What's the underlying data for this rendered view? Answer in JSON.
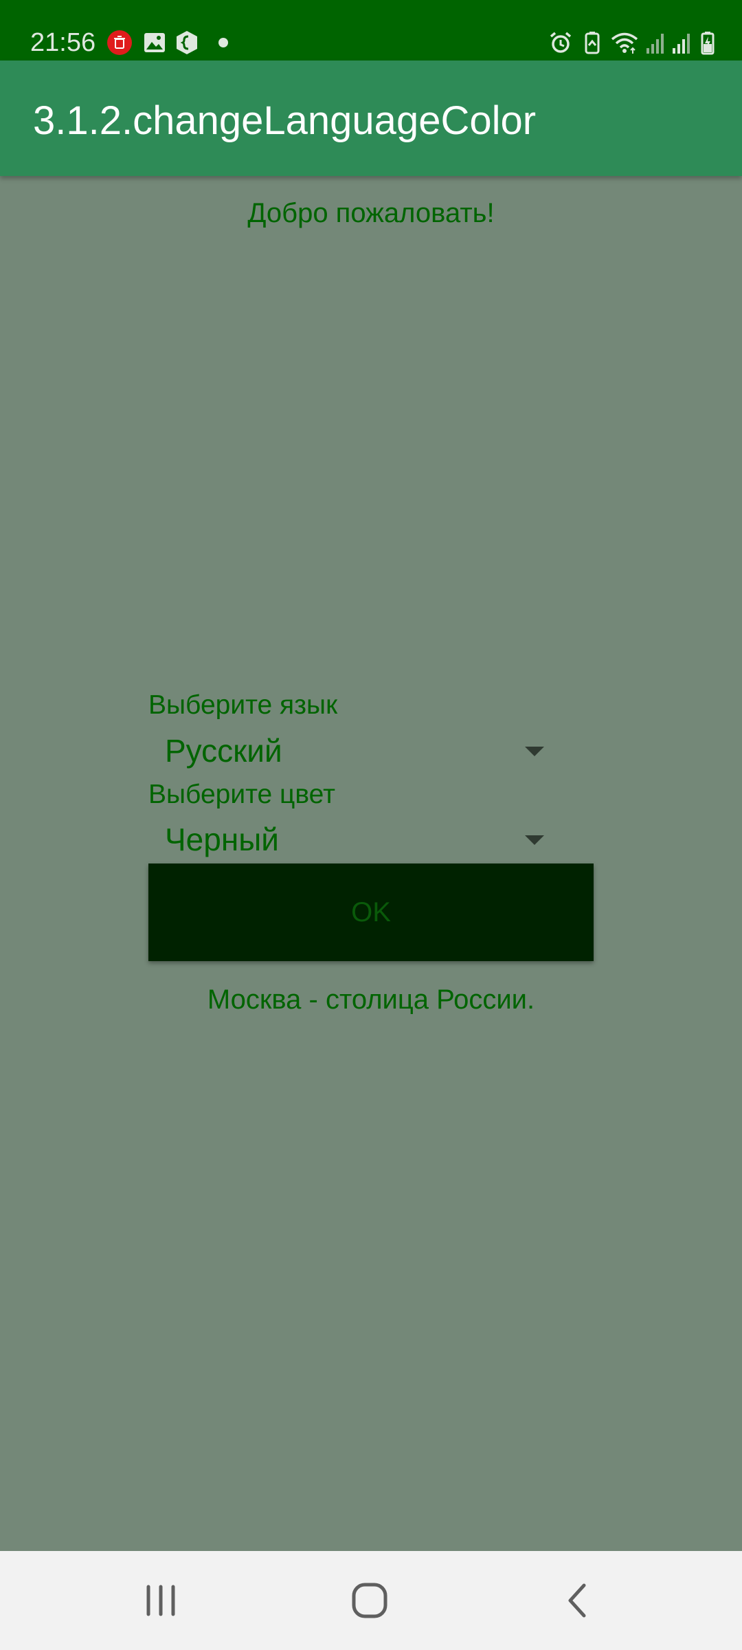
{
  "status_bar": {
    "time": "21:56",
    "left_icons": [
      "delete-notification-icon",
      "image-icon",
      "app-shield-icon",
      "dot-indicator"
    ],
    "right_icons": [
      "alarm-icon",
      "battery-saver-icon",
      "wifi-icon",
      "signal-icon",
      "signal-icon-2",
      "battery-charging-icon"
    ]
  },
  "app_bar": {
    "title": "3.1.2.changeLanguageColor",
    "color": "#2e8b57"
  },
  "main": {
    "welcome": "Добро пожаловать!",
    "language_label": "Выберите язык",
    "language_value": "Русский",
    "color_label": "Выберите цвет",
    "color_value": "Черный",
    "ok_label": "OK",
    "capital_text": "Москва - столица России.",
    "text_color": "#006400",
    "background": "#748878"
  },
  "nav_bar": {
    "buttons": [
      "recent-apps-icon",
      "home-icon",
      "back-icon"
    ]
  }
}
